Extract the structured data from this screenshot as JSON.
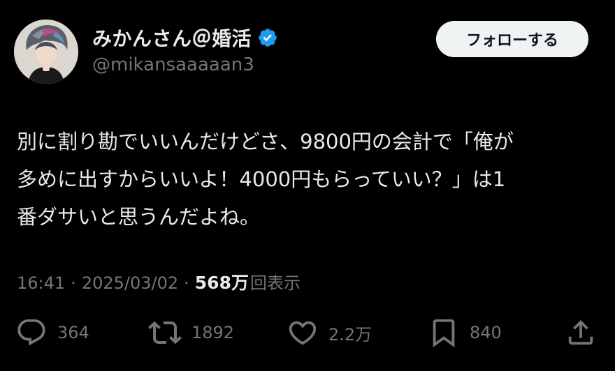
{
  "author": {
    "display_name": "みかんさん＠婚活",
    "handle": "@mikansaaaaan3",
    "verified_icon": "verified-badge-icon",
    "verified_color": "#1d9bf0"
  },
  "follow_button": {
    "label": "フォローする"
  },
  "tweet": {
    "lines": [
      "別に割り勘でいいんだけどさ、9800円の会計で「俺が",
      "多めに出すからいいよ！4000円もらっていい？」は1",
      "番ダサいと思うんだよね。"
    ]
  },
  "meta": {
    "time": "16:41",
    "separator": "·",
    "date": "2025/03/02",
    "views_count": "568万",
    "views_label": "回表示"
  },
  "actions": {
    "reply": {
      "icon": "reply-icon",
      "count": "364"
    },
    "retweet": {
      "icon": "retweet-icon",
      "count": "1892"
    },
    "like": {
      "icon": "heart-icon",
      "count": "2.2万"
    },
    "bookmark": {
      "icon": "bookmark-icon",
      "count": "840"
    },
    "share": {
      "icon": "share-icon"
    }
  },
  "colors": {
    "background": "#000000",
    "text_primary": "#e7e9ea",
    "text_secondary": "#71767b",
    "button_bg": "#eff3f4"
  }
}
